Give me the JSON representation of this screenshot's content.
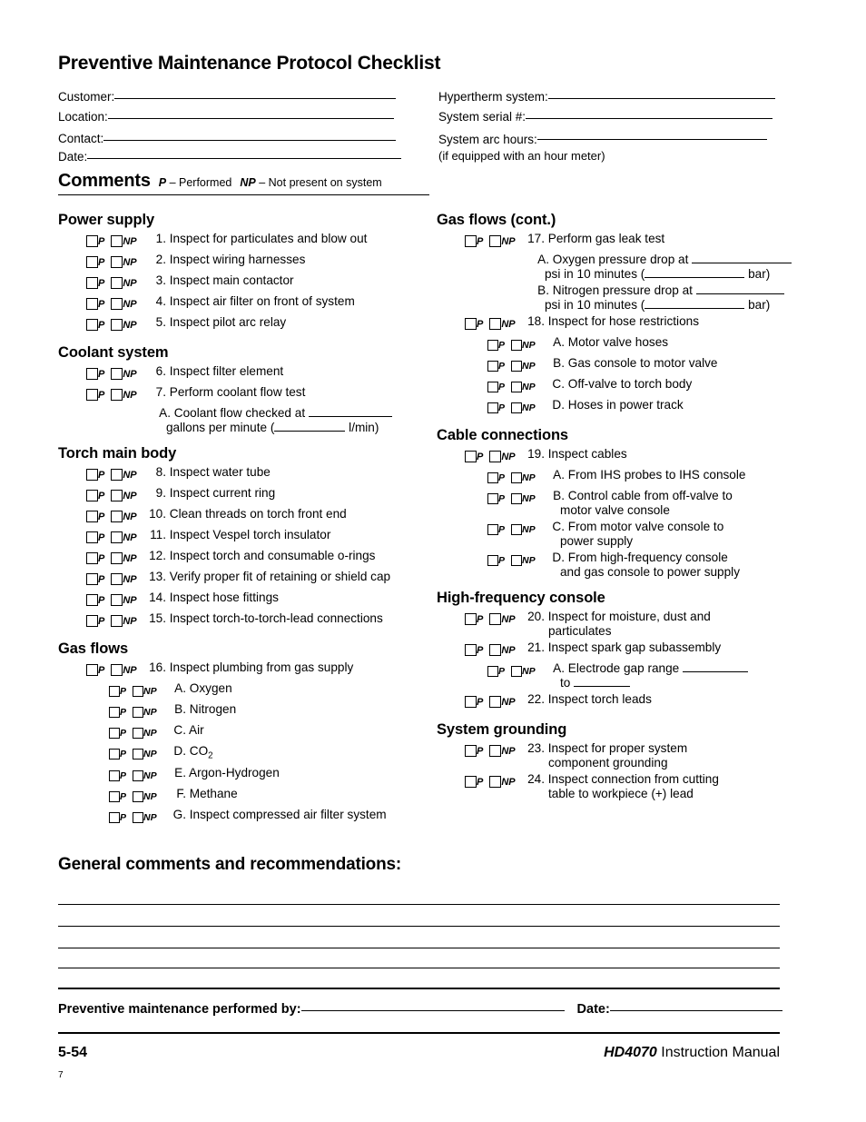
{
  "title": "Preventive Maintenance Protocol Checklist",
  "header": {
    "left_fields": [
      {
        "label": "Customer:"
      },
      {
        "label": "Location:"
      },
      {
        "label": "Contact:"
      },
      {
        "label": "Date:"
      }
    ],
    "right_fields": [
      {
        "label": "Hypertherm system:"
      },
      {
        "label": "System serial #:"
      },
      {
        "label": "System arc hours:"
      }
    ],
    "hour_meter_note": "(if equipped with an hour meter)"
  },
  "comments_bar": {
    "heading": "Comments",
    "key_p": "P",
    "p_meaning": "– Performed",
    "key_np": "NP",
    "np_meaning": "– Not present on system"
  },
  "checkbox_labels": {
    "p": "P",
    "np": "NP"
  },
  "left_column": [
    {
      "title": "Power supply",
      "items": [
        {
          "num": "1.",
          "text": "Inspect for particulates and blow out",
          "boxes": true
        },
        {
          "num": "2.",
          "text": "Inspect wiring harnesses",
          "boxes": true
        },
        {
          "num": "3.",
          "text": "Inspect main contactor",
          "boxes": true
        },
        {
          "num": "4.",
          "text": "Inspect air filter on front of system",
          "boxes": true
        },
        {
          "num": "5.",
          "text": "Inspect pilot arc relay",
          "boxes": true
        }
      ]
    },
    {
      "title": "Coolant system",
      "items": [
        {
          "num": "6.",
          "text": "Inspect filter element",
          "boxes": true
        },
        {
          "num": "7.",
          "text": "Perform coolant flow test",
          "boxes": true
        },
        {
          "num": "A.",
          "text": "Coolant flow checked at ",
          "boxes": false,
          "sub": true,
          "blank_after": 92,
          "cont_pre": "gallons per minute  (",
          "cont_blank": 78,
          "cont_post": " l/min)"
        }
      ]
    },
    {
      "title": "Torch main body",
      "items": [
        {
          "num": "8.",
          "text": "Inspect water tube",
          "boxes": true
        },
        {
          "num": "9.",
          "text": "Inspect current ring",
          "boxes": true
        },
        {
          "num": "10.",
          "text": "Clean threads on torch front end",
          "boxes": true
        },
        {
          "num": "11.",
          "text": "Inspect Vespel torch insulator",
          "boxes": true
        },
        {
          "num": "12.",
          "text": "Inspect torch and consumable o-rings",
          "boxes": true
        },
        {
          "num": "13.",
          "text": "Verify proper fit of retaining or shield cap",
          "boxes": true
        },
        {
          "num": "14.",
          "text": "Inspect hose fittings",
          "boxes": true
        },
        {
          "num": "15.",
          "text": "Inspect torch-to-torch-lead connections",
          "boxes": true
        }
      ]
    },
    {
      "title": "Gas flows",
      "items": [
        {
          "num": "16.",
          "text": "Inspect plumbing from gas supply",
          "boxes": true
        },
        {
          "num": "A.",
          "text": "Oxygen",
          "boxes": true,
          "sub": true
        },
        {
          "num": "B.",
          "text": "Nitrogen",
          "boxes": true,
          "sub": true
        },
        {
          "num": "C.",
          "text": "Air",
          "boxes": true,
          "sub": true
        },
        {
          "num": "D.",
          "text": "CO",
          "subscript": "2",
          "boxes": true,
          "sub": true
        },
        {
          "num": "E.",
          "text": "Argon-Hydrogen",
          "boxes": true,
          "sub": true
        },
        {
          "num": "F.",
          "text": "Methane",
          "boxes": true,
          "sub": true
        },
        {
          "num": "G.",
          "text": "Inspect compressed air filter system",
          "boxes": true,
          "sub": true
        }
      ]
    }
  ],
  "right_column": [
    {
      "title": "Gas flows (cont.)",
      "items": [
        {
          "num": "17.",
          "text": "Perform gas leak test",
          "boxes": true
        },
        {
          "num": "A.",
          "text": "Oxygen pressure drop at ",
          "boxes": false,
          "sub": true,
          "blank_after": 110,
          "cont_pre": "psi in 10 minutes (",
          "cont_blank": 110,
          "cont_post": " bar)"
        },
        {
          "num": "B.",
          "text": "Nitrogen pressure drop at ",
          "boxes": false,
          "sub": true,
          "blank_after": 97,
          "cont_pre": "psi in 10 minutes (",
          "cont_blank": 110,
          "cont_post": " bar)"
        },
        {
          "num": "18.",
          "text": "Inspect for hose restrictions",
          "boxes": true
        },
        {
          "num": "A.",
          "text": "Motor valve hoses",
          "boxes": true,
          "sub": true
        },
        {
          "num": "B.",
          "text": "Gas console to motor valve",
          "boxes": true,
          "sub": true
        },
        {
          "num": "C.",
          "text": "Off-valve to torch body",
          "boxes": true,
          "sub": true
        },
        {
          "num": "D.",
          "text": "Hoses in power track",
          "boxes": true,
          "sub": true
        }
      ]
    },
    {
      "title": "Cable connections",
      "items": [
        {
          "num": "19.",
          "text": "Inspect cables",
          "boxes": true
        },
        {
          "num": "A.",
          "text": "From IHS probes to IHS console",
          "boxes": true,
          "sub": true
        },
        {
          "num": "B.",
          "text": "Control cable from off-valve to",
          "cont_text": "motor valve console",
          "boxes": true,
          "sub": true
        },
        {
          "num": "C.",
          "text": "From motor valve console to",
          "cont_text": "power supply",
          "boxes": true,
          "sub": true
        },
        {
          "num": "D.",
          "text": "From high-frequency console",
          "cont_text": "and gas console to power supply",
          "boxes": true,
          "sub": true
        }
      ]
    },
    {
      "title": "High-frequency console",
      "items": [
        {
          "num": "20.",
          "text": "Inspect for moisture, dust and",
          "cont_text": "particulates",
          "boxes": true
        },
        {
          "num": "21.",
          "text": "Inspect spark gap subassembly",
          "boxes": true
        },
        {
          "num": "A.",
          "text": "Electrode gap range ",
          "boxes": true,
          "sub": true,
          "blank_after": 72,
          "cont_pre": "to ",
          "cont_blank": 62,
          "cont_post": ""
        },
        {
          "num": "22.",
          "text": "Inspect torch leads",
          "boxes": true
        }
      ]
    },
    {
      "title": "System grounding",
      "items": [
        {
          "num": "23.",
          "text": "Inspect for proper system",
          "cont_text": "component grounding",
          "boxes": true
        },
        {
          "num": "24.",
          "text": "Inspect connection from cutting",
          "cont_text": "table to workpiece (+) lead",
          "boxes": true
        }
      ]
    }
  ],
  "general_comments": {
    "title": "General comments and recommendations:",
    "line_count": 5
  },
  "footer": {
    "performed_by_label": "Preventive maintenance performed by:",
    "date_label": "Date:",
    "page_number": "5-54",
    "manual_model": "HD4070",
    "manual_text": " Instruction Manual",
    "sheet_number": "7"
  }
}
